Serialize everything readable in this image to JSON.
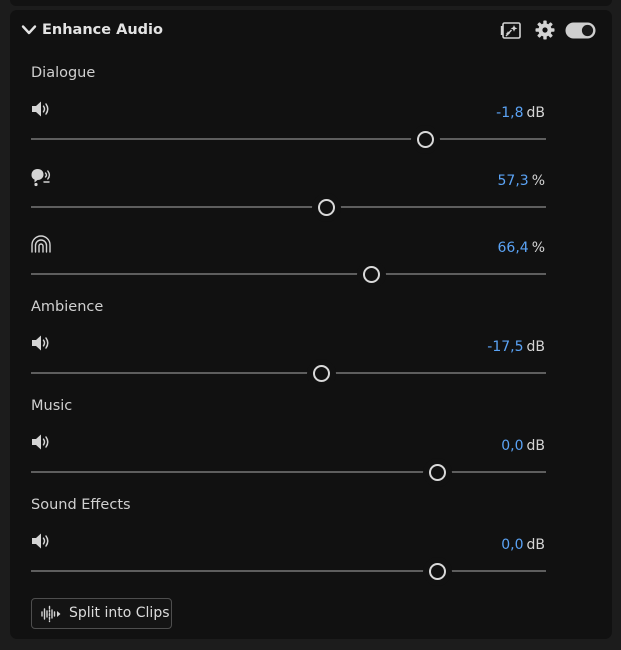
{
  "panel": {
    "title": "Enhance Audio",
    "header_icons": [
      "enhance-preview-icon",
      "gear-icon",
      "toggle-switch"
    ],
    "toggle_on": true
  },
  "sections": {
    "dialogue": {
      "label": "Dialogue",
      "controls": [
        {
          "icon": "volume-icon",
          "value": "-1,8",
          "unit": "dB",
          "level": 0.765
        },
        {
          "icon": "voice-speaker-icon",
          "value": "57,3",
          "unit": "%",
          "level": 0.573
        },
        {
          "icon": "reverb-arcs-icon",
          "value": "66,4",
          "unit": "%",
          "level": 0.66
        }
      ]
    },
    "ambience": {
      "label": "Ambience",
      "controls": [
        {
          "icon": "volume-icon",
          "value": "-17,5",
          "unit": "dB",
          "level": 0.563
        }
      ]
    },
    "music": {
      "label": "Music",
      "controls": [
        {
          "icon": "volume-icon",
          "value": "0,0",
          "unit": "dB",
          "level": 0.788
        }
      ]
    },
    "sound_effects": {
      "label": "Sound Effects",
      "controls": [
        {
          "icon": "volume-icon",
          "value": "0,0",
          "unit": "dB",
          "level": 0.788
        }
      ]
    }
  },
  "split_button": {
    "label": "Split into Clips",
    "icon": "split-waveform-icon"
  },
  "colors": {
    "accent_value": "#5ba3f5",
    "panel_bg": "#111111",
    "track": "#5e5e5e"
  }
}
